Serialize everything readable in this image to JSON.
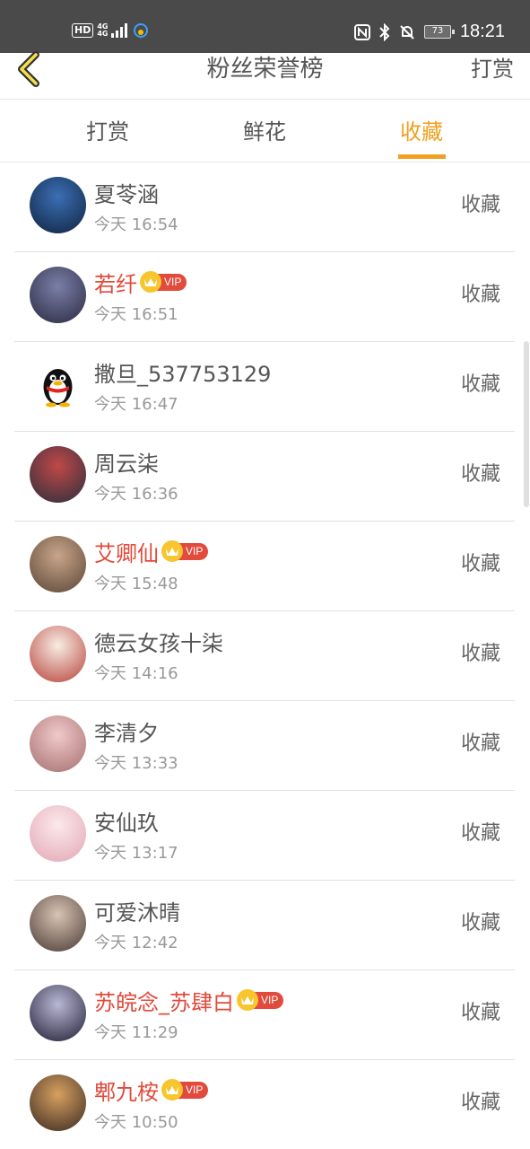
{
  "status_bar": {
    "hd": "HD",
    "net_top": "4G",
    "net_bottom": "4G",
    "time": "18:21",
    "battery": "73"
  },
  "header": {
    "title": "粉丝荣誉榜",
    "action": "打赏"
  },
  "tabs": [
    {
      "label": "打赏",
      "active": false
    },
    {
      "label": "鲜花",
      "active": false
    },
    {
      "label": "收藏",
      "active": true
    }
  ],
  "accent_color": "#f0a020",
  "vip_color": "#e24a3b",
  "vip_text": "VIP",
  "fans": [
    {
      "name": "夏苓涵",
      "time": "今天 16:54",
      "action": "收藏",
      "vip": false,
      "avatar_colors": [
        "#3b6fb5",
        "#10233f"
      ]
    },
    {
      "name": "若纤",
      "time": "今天 16:51",
      "action": "收藏",
      "vip": true,
      "avatar_colors": [
        "#7a7fa8",
        "#2a2a40"
      ]
    },
    {
      "name": "撒旦_537753129",
      "time": "今天 16:47",
      "action": "收藏",
      "vip": false,
      "avatar_colors": [
        "#ffffff",
        "#ffffff"
      ],
      "avatar_icon": "qq-penguin-icon"
    },
    {
      "name": "周云柒",
      "time": "今天 16:36",
      "action": "收藏",
      "vip": false,
      "avatar_colors": [
        "#c04848",
        "#2b2f3c"
      ]
    },
    {
      "name": "艾卿仙",
      "time": "今天 15:48",
      "action": "收藏",
      "vip": true,
      "avatar_colors": [
        "#c9a58a",
        "#5a4636"
      ]
    },
    {
      "name": "德云女孩十柒",
      "time": "今天 14:16",
      "action": "收藏",
      "vip": false,
      "avatar_colors": [
        "#f7ede4",
        "#b7423a"
      ]
    },
    {
      "name": "李清夕",
      "time": "今天 13:33",
      "action": "收藏",
      "vip": false,
      "avatar_colors": [
        "#f1c9c9",
        "#a46f6f"
      ]
    },
    {
      "name": "安仙玖",
      "time": "今天 13:17",
      "action": "收藏",
      "vip": false,
      "avatar_colors": [
        "#fbe9ec",
        "#e3a6b4"
      ]
    },
    {
      "name": "可爱沐晴",
      "time": "今天 12:42",
      "action": "收藏",
      "vip": false,
      "avatar_colors": [
        "#d8c4b4",
        "#4a3a34"
      ]
    },
    {
      "name": "苏皖念_苏肆白",
      "time": "今天 11:29",
      "action": "收藏",
      "vip": true,
      "avatar_colors": [
        "#b9b8d4",
        "#201e35"
      ]
    },
    {
      "name": "郫九桉",
      "time": "今天 10:50",
      "action": "收藏",
      "vip": true,
      "avatar_colors": [
        "#d7a060",
        "#3a2a22"
      ]
    }
  ]
}
